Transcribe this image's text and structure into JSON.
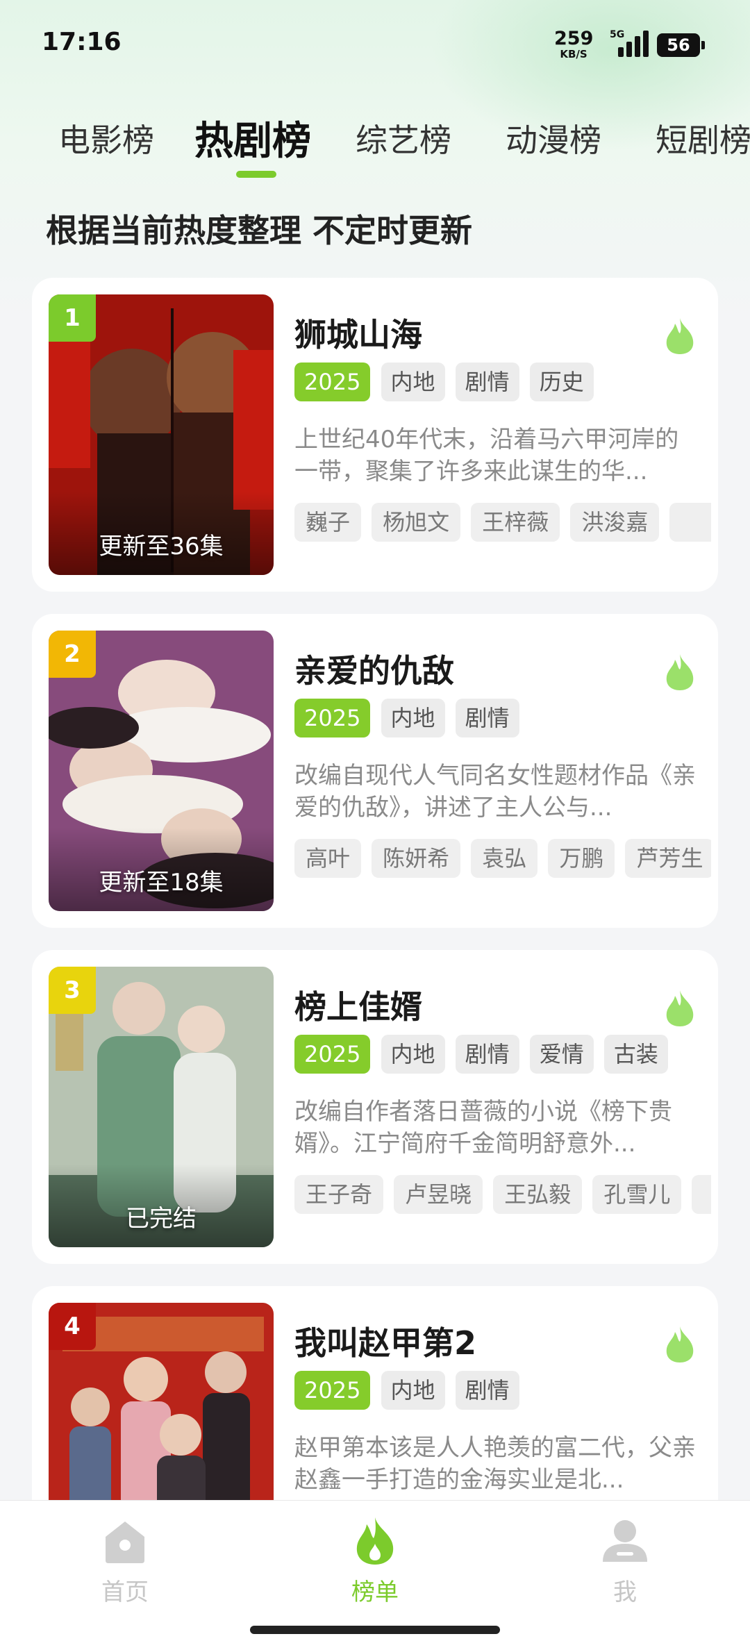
{
  "status_bar": {
    "time": "17:16",
    "net_speed": "259",
    "net_unit": "KB/S",
    "network": "5G",
    "battery": "56"
  },
  "tabs": [
    {
      "label": "电影榜",
      "active": false
    },
    {
      "label": "热剧榜",
      "active": true
    },
    {
      "label": "综艺榜",
      "active": false
    },
    {
      "label": "动漫榜",
      "active": false
    },
    {
      "label": "短剧榜",
      "active": false
    }
  ],
  "subtitle": "根据当前热度整理 不定时更新",
  "items": [
    {
      "rank": "1",
      "rank_color": "#7ccb2c",
      "title": "狮城山海",
      "poster_status": "更新至36集",
      "tags": [
        "2025",
        "内地",
        "剧情",
        "历史"
      ],
      "description": "上世纪40年代末，沿着马六甲河岸的一带，聚集了许多来此谋生的华...",
      "cast": [
        "巍子",
        "杨旭文",
        "王梓薇",
        "洪浚嘉",
        ""
      ],
      "poster_colors": [
        "#b8160f",
        "#5a0c08"
      ]
    },
    {
      "rank": "2",
      "rank_color": "#f2b705",
      "title": "亲爱的仇敌",
      "poster_status": "更新至18集",
      "tags": [
        "2025",
        "内地",
        "剧情"
      ],
      "description": "改编自现代人气同名女性题材作品《亲爱的仇敌》，讲述了主人公与...",
      "cast": [
        "高叶",
        "陈妍希",
        "袁弘",
        "万鹏",
        "芦芳生"
      ],
      "poster_colors": [
        "#8a4a7c",
        "#4a2a4e"
      ]
    },
    {
      "rank": "3",
      "rank_color": "#e8d40d",
      "title": "榜上佳婿",
      "poster_status": "已完结",
      "tags": [
        "2025",
        "内地",
        "剧情",
        "爱情",
        "古装"
      ],
      "description": "改编自作者落日蔷薇的小说《榜下贵婿》。江宁简府千金简明舒意外...",
      "cast": [
        "王子奇",
        "卢昱晓",
        "王弘毅",
        "孔雪儿",
        ""
      ],
      "poster_colors": [
        "#a9b8a6",
        "#4f6d58"
      ]
    },
    {
      "rank": "4",
      "rank_color": "#b8160f",
      "title": "我叫赵甲第2",
      "poster_status": "",
      "tags": [
        "2025",
        "内地",
        "剧情"
      ],
      "description": "赵甲第本该是人人艳羡的富二代，父亲赵鑫一手打造的金海实业是北...",
      "cast": [],
      "poster_colors": [
        "#c0281c",
        "#7a120c"
      ]
    }
  ],
  "bottom_nav": [
    {
      "label": "首页",
      "icon": "home-icon",
      "active": false
    },
    {
      "label": "榜单",
      "icon": "flame-icon",
      "active": true
    },
    {
      "label": "我",
      "icon": "user-icon",
      "active": false
    }
  ],
  "colors": {
    "accent": "#7ccb2c",
    "year_tag": "#85cc2b",
    "flame": "#9be06a"
  }
}
